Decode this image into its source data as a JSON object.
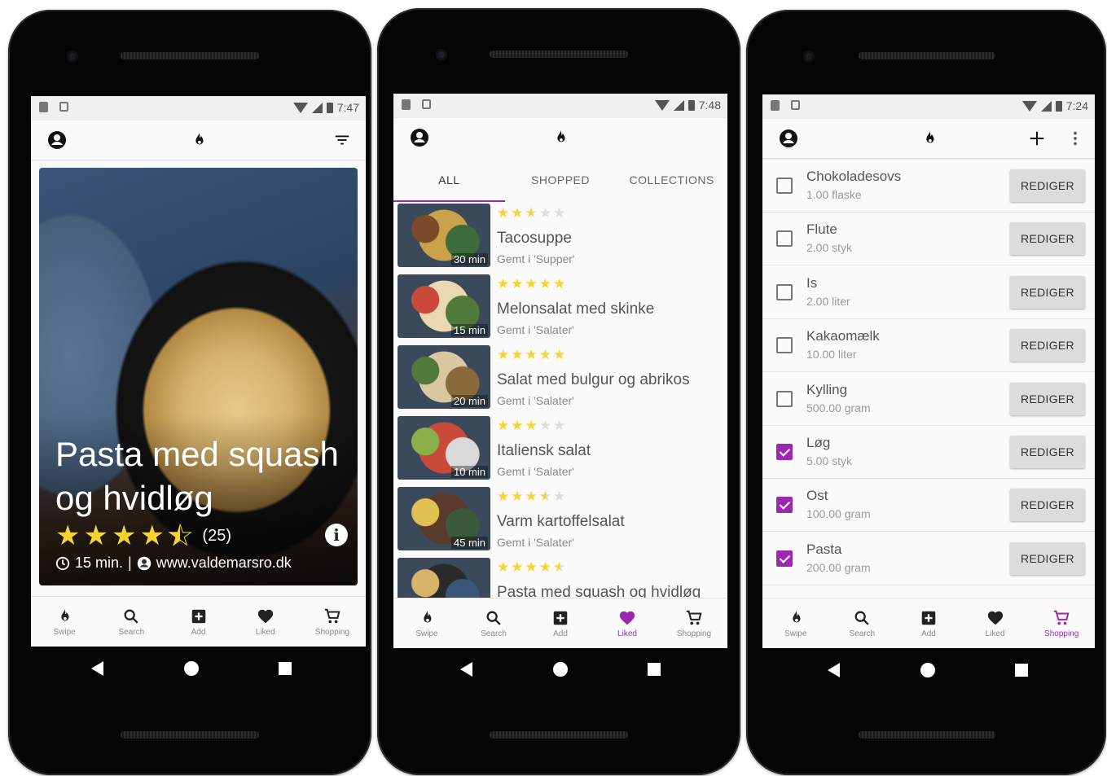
{
  "phone1": {
    "status_time": "7:47",
    "recipe": {
      "title": "Pasta med squash og hvidløg",
      "rating": 4.5,
      "rating_count": "(25)",
      "duration": "15 min.",
      "source": "www.valdemarsro.dk"
    }
  },
  "phone2": {
    "status_time": "7:48",
    "tabs": [
      "ALL",
      "SHOPPED",
      "COLLECTIONS"
    ],
    "recipes": [
      {
        "name": "Tacosuppe",
        "saved": "Gemt i 'Supper'",
        "duration": "30 min",
        "rating": 2.5,
        "colors": [
          "#7a4a2a",
          "#3d6b3a",
          "#c9a24a"
        ]
      },
      {
        "name": "Melonsalat med skinke",
        "saved": "Gemt i 'Salater'",
        "duration": "15 min",
        "rating": 5,
        "colors": [
          "#c94a3a",
          "#4f7a3a",
          "#e8d9b0"
        ]
      },
      {
        "name": "Salat med bulgur og abrikos",
        "saved": "Gemt i 'Salater'",
        "duration": "20 min",
        "rating": 5,
        "colors": [
          "#4f7a3a",
          "#8a6a3a",
          "#d9c7a0"
        ]
      },
      {
        "name": "Italiensk salat",
        "saved": "Gemt i 'Salater'",
        "duration": "10 min",
        "rating": 3,
        "colors": [
          "#8ab04a",
          "#d9d9d9",
          "#c94a3a"
        ]
      },
      {
        "name": "Varm kartoffelsalat",
        "saved": "Gemt i 'Salater'",
        "duration": "45 min",
        "rating": 3.5,
        "colors": [
          "#e0c050",
          "#3a5a3a",
          "#5a3a2a"
        ]
      },
      {
        "name": "Pasta med squash og hvidløg",
        "saved": "",
        "duration": "",
        "rating": 4.5,
        "colors": [
          "#d9b26b",
          "#3a5678",
          "#2a2a2a"
        ]
      }
    ]
  },
  "phone3": {
    "status_time": "7:24",
    "button_label": "REDIGER",
    "items": [
      {
        "name": "Chokoladesovs",
        "qty": "1.00 flaske",
        "checked": false
      },
      {
        "name": "Flute",
        "qty": "2.00 styk",
        "checked": false
      },
      {
        "name": "Is",
        "qty": "2.00 liter",
        "checked": false
      },
      {
        "name": "Kakaomælk",
        "qty": "10.00 liter",
        "checked": false
      },
      {
        "name": "Kylling",
        "qty": "500.00 gram",
        "checked": false
      },
      {
        "name": "Løg",
        "qty": "5.00 styk",
        "checked": true
      },
      {
        "name": "Ost",
        "qty": "100.00 gram",
        "checked": true
      },
      {
        "name": "Pasta",
        "qty": "200.00 gram",
        "checked": true
      }
    ]
  },
  "nav": {
    "swipe": "Swipe",
    "search": "Search",
    "add": "Add",
    "liked": "Liked",
    "shopping": "Shopping"
  },
  "colors": {
    "accent": "#9c27b0",
    "star": "#f7d332"
  }
}
